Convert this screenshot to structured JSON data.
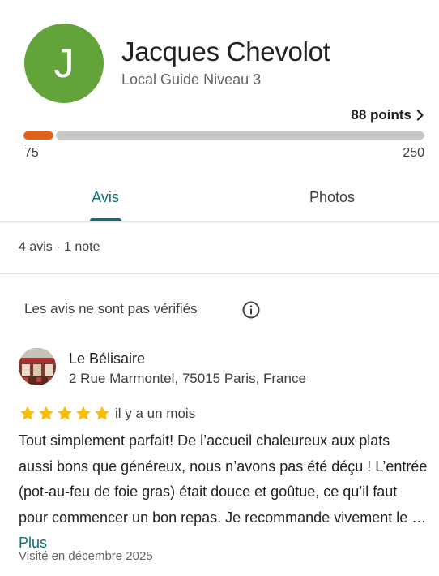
{
  "profile": {
    "avatar_initial": "J",
    "avatar_color": "#62a33a",
    "name": "Jacques Chevolot",
    "level": "Local Guide Niveau 3",
    "points_label": "88 points",
    "progress": {
      "min_label": "75",
      "max_label": "250",
      "fill_fraction": 0.075,
      "fill_color": "#e2621b",
      "track_color": "#c7c7c7"
    }
  },
  "tabs": [
    {
      "label": "Avis",
      "active": true
    },
    {
      "label": "Photos",
      "active": false
    }
  ],
  "counts_text": "4 avis · 1 note",
  "notice": {
    "text": "Les avis ne sont pas vérifiés",
    "icon": "info-icon"
  },
  "review": {
    "place_name": "Le Bélisaire",
    "place_address": "2 Rue Marmontel, 75015 Paris, France",
    "rating": 5,
    "star_color": "#fbbc04",
    "date": "il y a un mois",
    "text": "Tout simplement parfait! De l’accueil chaleureux aux plats aussi bons que généreux, nous n’avons pas été déçu ! L’entrée (pot-au-feu de foie gras) était douce et goûtue, ce qu’il faut pour commencer un bon repas. Je recommande vivement le …",
    "more_label": "Plus",
    "visited": "Visité en décembre 2025"
  },
  "accent_color": "#0b6f7a"
}
